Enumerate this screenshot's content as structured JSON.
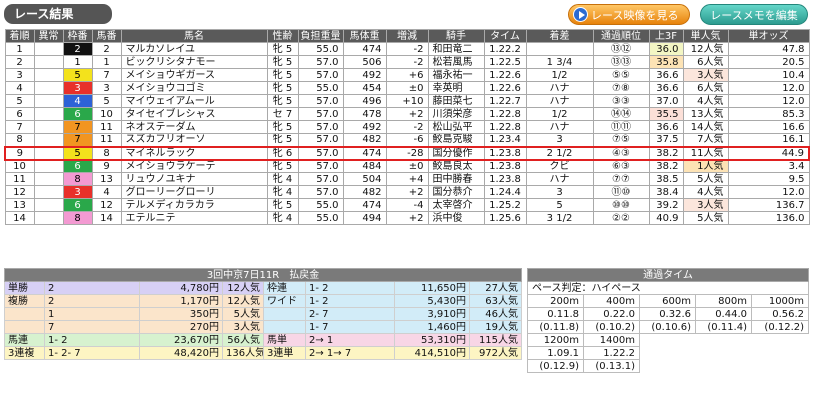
{
  "header": {
    "title": "レース結果",
    "video_button": "レース映像を見る",
    "memo_button": "レースメモを編集"
  },
  "results": {
    "columns": [
      "着順",
      "異常",
      "枠番",
      "馬番",
      "馬名",
      "性齢",
      "負担重量",
      "馬体重",
      "増減",
      "騎手",
      "タイム",
      "着差",
      "通過順位",
      "上3F",
      "単人気",
      "単オッズ"
    ],
    "rows": [
      [
        "1",
        "",
        "2",
        "2",
        "マルカソレイユ",
        "牝 5",
        "55.0",
        "474",
        "-2",
        "和田竜二",
        "1.22.2",
        "",
        "⑬⑫",
        "36.0",
        "12人気",
        "47.8"
      ],
      [
        "2",
        "",
        "1",
        "1",
        "ビックリシタナモー",
        "牝 5",
        "57.0",
        "506",
        "-2",
        "松若風馬",
        "1.22.5",
        "1 3/4",
        "⑬⑬",
        "35.8",
        "6人気",
        "20.5"
      ],
      [
        "3",
        "",
        "5",
        "7",
        "メイショウギガース",
        "牝 5",
        "57.0",
        "492",
        "+6",
        "福永祐一",
        "1.22.6",
        "1/2",
        "⑤⑤",
        "36.6",
        "3人気",
        "10.4"
      ],
      [
        "4",
        "",
        "3",
        "3",
        "メイショウコゴミ",
        "牝 5",
        "55.0",
        "454",
        "±0",
        "幸英明",
        "1.22.6",
        "ハナ",
        "⑦⑧",
        "36.6",
        "6人気",
        "12.0"
      ],
      [
        "5",
        "",
        "4",
        "5",
        "マイウェイアムール",
        "牝 5",
        "57.0",
        "496",
        "+10",
        "藤田菜七",
        "1.22.7",
        "ハナ",
        "③③",
        "37.0",
        "4人気",
        "12.0"
      ],
      [
        "6",
        "",
        "6",
        "10",
        "タイセイブレシャス",
        "セ 7",
        "57.0",
        "478",
        "+2",
        "川須栄彦",
        "1.22.8",
        "1/2",
        "⑭⑭",
        "35.5",
        "13人気",
        "85.3"
      ],
      [
        "7",
        "",
        "7",
        "11",
        "ネオステーダム",
        "牝 5",
        "57.0",
        "492",
        "-2",
        "松山弘平",
        "1.22.8",
        "ハナ",
        "⑪⑪",
        "36.6",
        "14人気",
        "16.6"
      ],
      [
        "8",
        "",
        "7",
        "11",
        "スズカフリオーソ",
        "牝 5",
        "57.0",
        "482",
        "-6",
        "鮫島克駿",
        "1.23.4",
        "3",
        "⑦⑤",
        "37.5",
        "7人気",
        "16.1"
      ],
      [
        "9",
        "",
        "5",
        "8",
        "マイネルラック",
        "牝 6",
        "57.0",
        "474",
        "-28",
        "国分優作",
        "1.23.8",
        "2 1/2",
        "④③",
        "38.2",
        "11人気",
        "44.9"
      ],
      [
        "10",
        "",
        "6",
        "9",
        "メイショウラケーテ",
        "牝 5",
        "57.0",
        "484",
        "±0",
        "鮫島良太",
        "1.23.8",
        "クビ",
        "⑥③",
        "38.2",
        "1人気",
        "3.4"
      ],
      [
        "11",
        "",
        "8",
        "13",
        "リュウノユキナ",
        "牝 4",
        "57.0",
        "504",
        "+4",
        "田中勝春",
        "1.23.8",
        "ハナ",
        "⑦⑦",
        "38.5",
        "5人気",
        "9.5"
      ],
      [
        "12",
        "",
        "3",
        "4",
        "グローリーグローリ",
        "牝 4",
        "57.0",
        "482",
        "+2",
        "国分恭介",
        "1.24.4",
        "3",
        "⑪⑩",
        "38.4",
        "4人気",
        "12.0"
      ],
      [
        "13",
        "",
        "6",
        "12",
        "テルメディカラカラ",
        "牝 5",
        "55.0",
        "474",
        "-4",
        "太宰啓介",
        "1.25.2",
        "5",
        "⑩⑩",
        "39.2",
        "3人気",
        "136.7"
      ],
      [
        "14",
        "",
        "8",
        "14",
        "エテルニテ",
        "牝 4",
        "55.0",
        "494",
        "+2",
        "浜中俊",
        "1.25.6",
        "3 1/2",
        "②②",
        "40.9",
        "5人気",
        "136.0"
      ]
    ]
  },
  "payout": {
    "title": "3回中京7日11R　払戻金",
    "left": [
      {
        "type": "単勝",
        "combo": "2",
        "amount": "4,780円",
        "pop": "12人気",
        "bg": "pa"
      },
      {
        "type": "複勝",
        "combo": "2",
        "amount": "1,170円",
        "pop": "12人気",
        "bg": "pb"
      },
      {
        "type": "",
        "combo": "1",
        "amount": "350円",
        "pop": "5人気",
        "bg": "pb"
      },
      {
        "type": "",
        "combo": "7",
        "amount": "270円",
        "pop": "3人気",
        "bg": "pb"
      },
      {
        "type": "馬連",
        "combo": "1- 2",
        "amount": "23,670円",
        "pop": "56人気",
        "bg": "pe"
      },
      {
        "type": "3連複",
        "combo": "1- 2- 7",
        "amount": "48,420円",
        "pop": "136人気",
        "bg": "pf"
      }
    ],
    "right": [
      {
        "type": "枠連",
        "combo": "1- 2",
        "amount": "11,650円",
        "pop": "27人気",
        "bg": "pc"
      },
      {
        "type": "ワイド",
        "combo": "1- 2",
        "amount": "5,430円",
        "pop": "63人気",
        "bg": "pc"
      },
      {
        "type": "",
        "combo": "2- 7",
        "amount": "3,910円",
        "pop": "46人気",
        "bg": "pc"
      },
      {
        "type": "",
        "combo": "1- 7",
        "amount": "1,460円",
        "pop": "19人気",
        "bg": "pc"
      },
      {
        "type": "馬単",
        "combo": "2→ 1",
        "amount": "53,310円",
        "pop": "115人気",
        "bg": "pd"
      },
      {
        "type": "3連単",
        "combo": "2→ 1→ 7",
        "amount": "414,510円",
        "pop": "972人気",
        "bg": "pf"
      }
    ]
  },
  "passing": {
    "title": "通過タイム",
    "judgement": "ペース判定：ハイペース",
    "row1": [
      {
        "dist": "200m",
        "time": "0.11.8",
        "cum": "(0.11.8)"
      },
      {
        "dist": "400m",
        "time": "0.22.0",
        "cum": "(0.10.2)"
      },
      {
        "dist": "600m",
        "time": "0.32.6",
        "cum": "(0.10.6)"
      },
      {
        "dist": "800m",
        "time": "0.44.0",
        "cum": "(0.11.4)"
      },
      {
        "dist": "1000m",
        "time": "0.56.2",
        "cum": "(0.12.2)"
      }
    ],
    "row2": [
      {
        "dist": "1200m",
        "time": "1.09.1",
        "cum": "(0.12.9)"
      },
      {
        "dist": "1400m",
        "time": "1.22.2",
        "cum": "(0.13.1)"
      }
    ]
  },
  "colors": {
    "highlight_row": "#e02020",
    "header_bg": "#5a5a5a"
  }
}
